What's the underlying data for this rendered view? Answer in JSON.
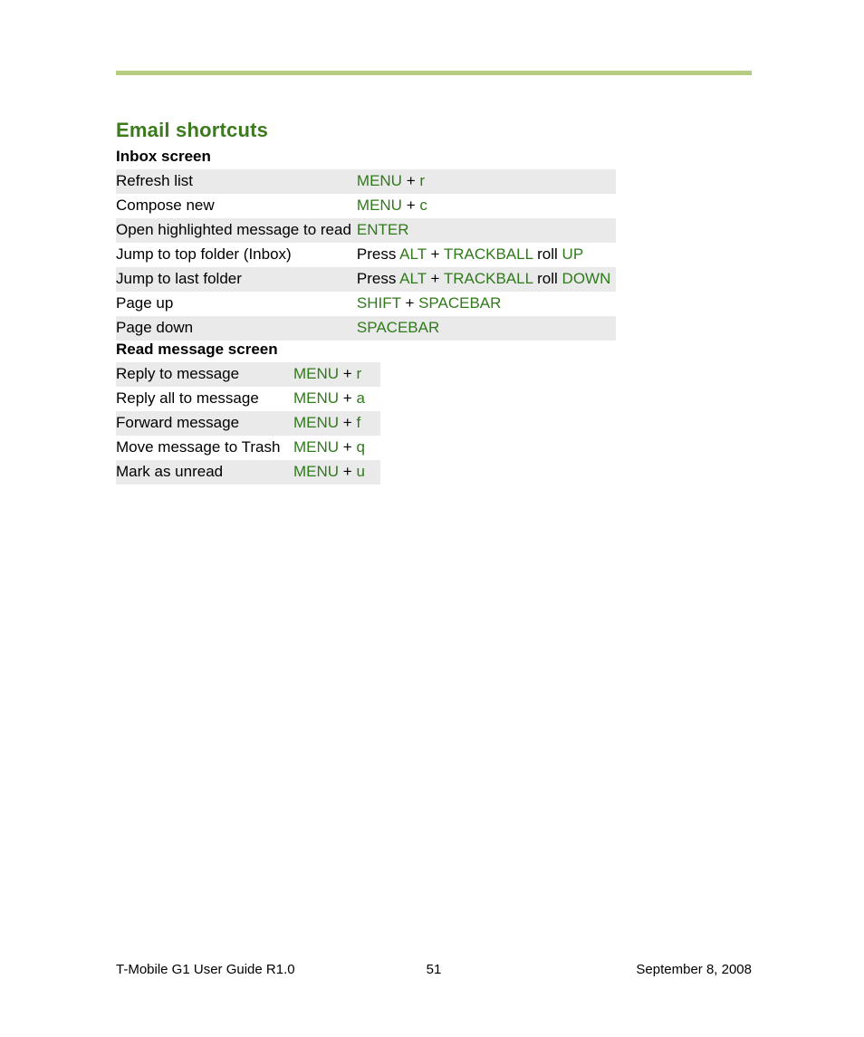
{
  "section_title": "Email shortcuts",
  "inbox": {
    "title": "Inbox screen",
    "rows": [
      {
        "action": "Refresh list",
        "keys": [
          {
            "t": "key",
            "v": "MENU"
          },
          {
            "t": "plus",
            "v": " + "
          },
          {
            "t": "key",
            "v": "r"
          }
        ]
      },
      {
        "action": "Compose new",
        "keys": [
          {
            "t": "key",
            "v": "MENU"
          },
          {
            "t": "plus",
            "v": " + "
          },
          {
            "t": "key",
            "v": "c"
          }
        ]
      },
      {
        "action": "Open highlighted message to read",
        "keys": [
          {
            "t": "key",
            "v": "ENTER"
          }
        ]
      },
      {
        "action": "Jump to top folder (Inbox)",
        "keys": [
          {
            "t": "plain",
            "v": "Press "
          },
          {
            "t": "key",
            "v": "ALT"
          },
          {
            "t": "plus",
            "v": " + "
          },
          {
            "t": "key",
            "v": "TRACKBALL"
          },
          {
            "t": "plain",
            "v": " roll "
          },
          {
            "t": "key",
            "v": "UP"
          }
        ]
      },
      {
        "action": "Jump to last folder",
        "keys": [
          {
            "t": "plain",
            "v": "Press "
          },
          {
            "t": "key",
            "v": "ALT"
          },
          {
            "t": "plus",
            "v": " + "
          },
          {
            "t": "key",
            "v": "TRACKBALL"
          },
          {
            "t": "plain",
            "v": " roll "
          },
          {
            "t": "key",
            "v": "DOWN"
          }
        ]
      },
      {
        "action": "Page up",
        "keys": [
          {
            "t": "key",
            "v": "SHIFT"
          },
          {
            "t": "plus",
            "v": " + "
          },
          {
            "t": "key",
            "v": "SPACEBAR"
          }
        ]
      },
      {
        "action": "Page down",
        "keys": [
          {
            "t": "key",
            "v": "SPACEBAR"
          }
        ]
      }
    ]
  },
  "read": {
    "title": "Read message screen",
    "rows": [
      {
        "action": "Reply to message",
        "keys": [
          {
            "t": "key",
            "v": "MENU"
          },
          {
            "t": "plus",
            "v": " + "
          },
          {
            "t": "key",
            "v": "r"
          }
        ]
      },
      {
        "action": "Reply all to message",
        "keys": [
          {
            "t": "key",
            "v": "MENU"
          },
          {
            "t": "plus",
            "v": " + "
          },
          {
            "t": "key",
            "v": "a"
          }
        ]
      },
      {
        "action": "Forward message",
        "keys": [
          {
            "t": "key",
            "v": "MENU"
          },
          {
            "t": "plus",
            "v": " + "
          },
          {
            "t": "key",
            "v": "f"
          }
        ]
      },
      {
        "action": "Move message to Trash",
        "keys": [
          {
            "t": "key",
            "v": "MENU"
          },
          {
            "t": "plus",
            "v": " + "
          },
          {
            "t": "key",
            "v": "q"
          }
        ]
      },
      {
        "action": "Mark as unread",
        "keys": [
          {
            "t": "key",
            "v": "MENU"
          },
          {
            "t": "plus",
            "v": " + "
          },
          {
            "t": "key",
            "v": "u"
          }
        ]
      }
    ]
  },
  "footer": {
    "left": "T-Mobile G1 User Guide R1.0",
    "center": "51",
    "right": "September 8, 2008"
  }
}
